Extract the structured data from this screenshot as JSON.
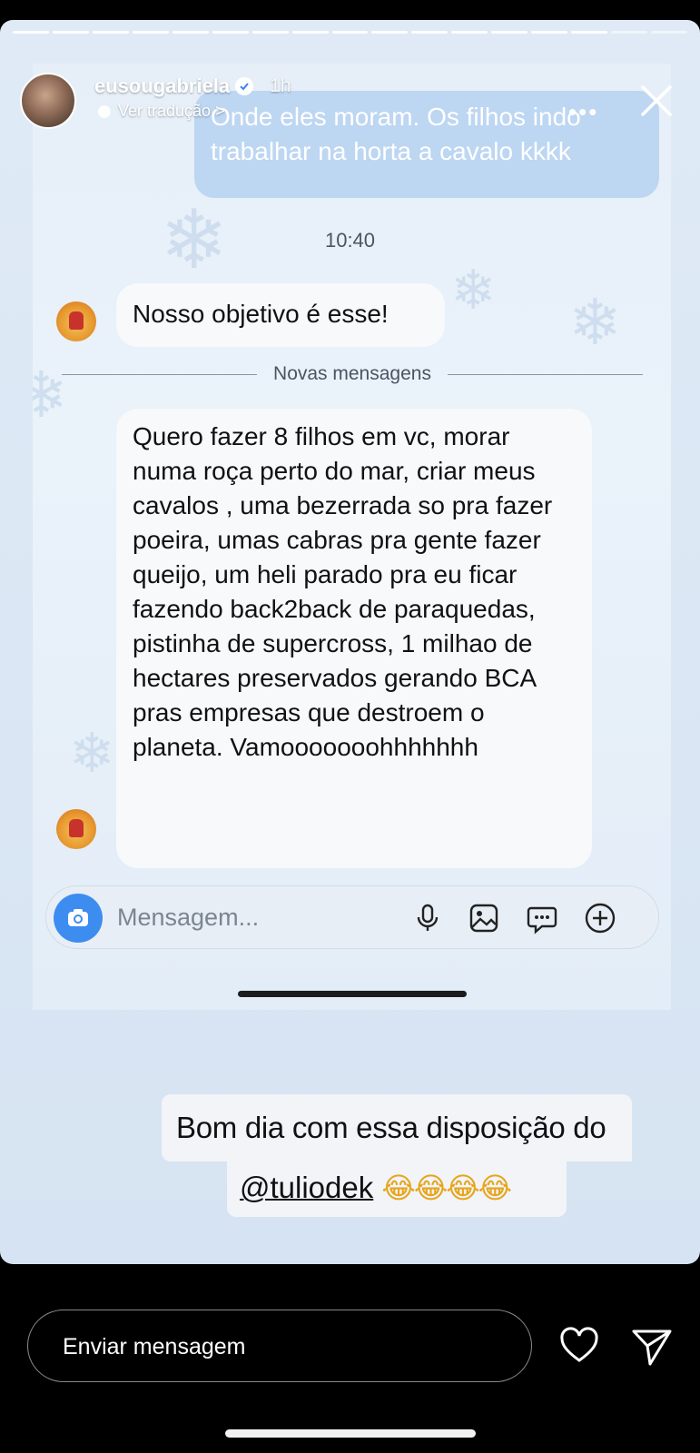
{
  "story": {
    "username": "eusougabriela",
    "age": "1h",
    "translate_link": "Ver tradução >",
    "progress_segments": 17,
    "progress_done": 15
  },
  "chat": {
    "sent_message": "Onde eles moram. Os filhos indo trabalhar na horta a cavalo kkkk",
    "timestamp": "10:40",
    "received_1": "Nosso objetivo é esse!",
    "new_messages_divider": "Novas mensagens",
    "received_2": "Quero fazer 8 filhos em vc, morar numa roça perto do mar, criar meus cavalos , uma bezerrada so pra fazer poeira, umas cabras pra gente fazer queijo, um heli parado pra eu ficar fazendo back2back de paraquedas, pistinha de supercross, 1 milhao de hectares preservados gerando BCA pras empresas que destroem o planeta. Vamooooooohhhhhhh",
    "composer_placeholder": "Mensagem..."
  },
  "caption": {
    "line1": "Bom dia com essa disposição do",
    "mention": "@tuliodek",
    "emojis": "😂😂😂😂"
  },
  "footer": {
    "reply_placeholder": "Enviar mensagem"
  },
  "icons": {
    "composer": [
      "camera-icon",
      "microphone-icon",
      "gallery-icon",
      "sticker-icon",
      "add-icon"
    ],
    "footer": [
      "heart-icon",
      "send-icon"
    ]
  },
  "colors": {
    "accent_blue": "#3d8cf0",
    "sent_bubble": "#bdd6f2"
  }
}
